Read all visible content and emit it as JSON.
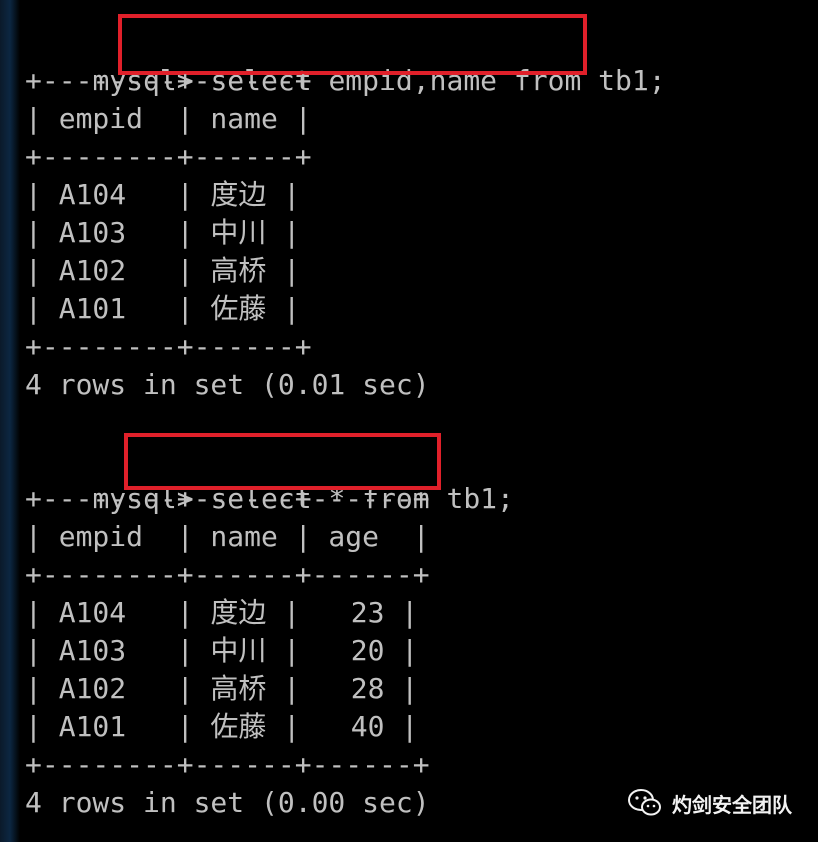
{
  "query1": {
    "prompt": "mysql>",
    "command": " select empid,name from tb1;",
    "border_top": "+--------+------+",
    "header": "| empid  | name |",
    "border_mid": "+--------+------+",
    "rows": [
      "| A104   | 度边 |",
      "| A103   | 中川 |",
      "| A102   | 高桥 |",
      "| A101   | 佐藤 |"
    ],
    "border_bottom": "+--------+------+",
    "result": "4 rows in set (0.01 sec)"
  },
  "query2": {
    "prompt": "mysql>",
    "command": " select * from tb1;",
    "border_top": "+--------+------+------+",
    "header": "| empid  | name | age  |",
    "border_mid": "+--------+------+------+",
    "rows": [
      "| A104   | 度边 |   23 |",
      "| A103   | 中川 |   20 |",
      "| A102   | 高桥 |   28 |",
      "| A101   | 佐藤 |   40 |"
    ],
    "border_bottom": "+--------+------+------+",
    "result": "4 rows in set (0.00 sec)"
  },
  "watermark": {
    "text": "灼剑安全团队",
    "icon": "wechat-icon"
  },
  "colors": {
    "background": "#000000",
    "text": "#c0c0c0",
    "highlight_box": "#e0202a"
  }
}
